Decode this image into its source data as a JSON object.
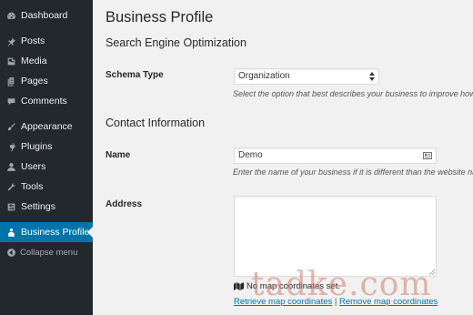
{
  "sidebar": {
    "items": [
      {
        "label": "Dashboard",
        "icon": "dashboard-icon"
      },
      {
        "label": "Posts",
        "icon": "pin-icon"
      },
      {
        "label": "Media",
        "icon": "media-icon"
      },
      {
        "label": "Pages",
        "icon": "pages-icon"
      },
      {
        "label": "Comments",
        "icon": "comment-icon"
      },
      {
        "label": "Appearance",
        "icon": "brush-icon"
      },
      {
        "label": "Plugins",
        "icon": "plug-icon"
      },
      {
        "label": "Users",
        "icon": "user-icon"
      },
      {
        "label": "Tools",
        "icon": "wrench-icon"
      },
      {
        "label": "Settings",
        "icon": "settings-icon"
      },
      {
        "label": "Business Profile",
        "icon": "business-icon",
        "active": true
      }
    ],
    "collapse_label": "Collapse menu",
    "colors": {
      "bg": "#23282d",
      "active": "#0073aa"
    }
  },
  "page": {
    "title": "Business Profile",
    "seo_heading": "Search Engine Optimization",
    "schema_label": "Schema Type",
    "schema_value": "Organization",
    "schema_desc": "Select the option that best describes your business to improve how s",
    "contact_heading": "Contact Information",
    "name_label": "Name",
    "name_value": "Demo",
    "name_desc": "Enter the name of your business if it is different than the website na",
    "address_label": "Address",
    "address_value": "",
    "map_status": "No map coordinates set.",
    "retrieve_link": "Retrieve map coordinates",
    "separator": "|",
    "remove_link": "Remove map coordinates"
  },
  "watermark": "tadke.com"
}
